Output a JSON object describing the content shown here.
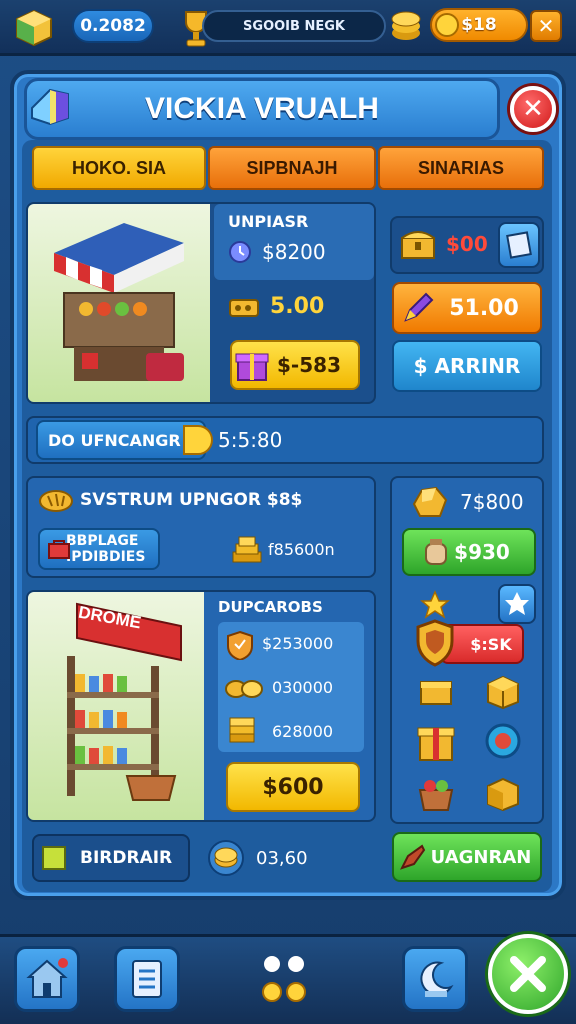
{
  "topbar": {
    "left_value": "0.2082",
    "center_label": "SGOOIB NEGK",
    "right_value": "$18",
    "close_label": "✕"
  },
  "header": {
    "title": "VICKIA VRUALH",
    "close_label": "✕"
  },
  "tabs": [
    {
      "label": "HOKO. SIA"
    },
    {
      "label": "SIPBNAJH"
    },
    {
      "label": "SINARIAS"
    }
  ],
  "stall_one": {
    "label": "UNPIASR",
    "price": "$8200",
    "coins": "5.00",
    "buy_button": "$-583"
  },
  "right_top": {
    "red_value": "$00",
    "orange_button": "51.00",
    "blue_button": "$ ARRINR"
  },
  "progress": {
    "label": "DO UFNCANGR",
    "value": "5:5:80"
  },
  "system": {
    "title": "SVSTRUM UPNGOR $8$",
    "button": "BBPLAGE IPDIBDIES",
    "value": "f85600n"
  },
  "right_mid": {
    "value": "7$800",
    "green_button": "$930",
    "badge_value": "$:SK"
  },
  "stall_two": {
    "sign": "DROME",
    "label": "DUPCAROBS",
    "row1": "$253000",
    "row2": "030000",
    "row3": "628000",
    "buy_button": "$600"
  },
  "footer": {
    "left_label": "BIRDRAIR",
    "coin_value": "03,60",
    "green_button": "UAGNRAN"
  },
  "colors": {
    "panel_blue": "#2c78c6",
    "accent_yellow": "#ffd43b",
    "accent_orange": "#f08a00",
    "accent_green": "#2ea52a",
    "danger_red": "#d92b2b"
  }
}
